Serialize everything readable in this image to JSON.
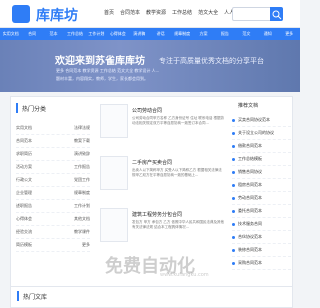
{
  "site": {
    "logo_text": "库库坊"
  },
  "header": {
    "nav": [
      "首页",
      "合同范本",
      "教学资源",
      "工作总结",
      "范文大全",
      "人人范文库"
    ],
    "search_placeholder": ""
  },
  "category_bar": [
    "实用文档",
    "合同",
    "范本",
    "工作总结",
    "工作计划",
    "心得体会",
    "演讲稿",
    "讲话",
    "规章制度",
    "方案",
    "报告",
    "范文",
    "通知",
    "更多"
  ],
  "hero": {
    "title": "欢迎来到苏雀库库坊",
    "subtitle": "专注于高质量优秀文档的分享平台",
    "line1": "更多 合同范本 教学资源 工作总结 范文大全 教学设计 人...",
    "line2": "题材丰富，内容翔实，教师，学生，家长都会用到。"
  },
  "left": {
    "title": "热门分类",
    "items": [
      {
        "name": "实用文档",
        "right": "法律法规"
      },
      {
        "name": "合同范本",
        "right": "教案下载"
      },
      {
        "name": "求职简历",
        "right": "演讲致辞"
      },
      {
        "name": "活动方案",
        "right": "工作报告"
      },
      {
        "name": "行政公文",
        "right": "党团工作"
      },
      {
        "name": "企业管理",
        "right": "规章制度"
      },
      {
        "name": "述职报告",
        "right": "工作计划"
      },
      {
        "name": "心得体会",
        "right": "其他文档"
      },
      {
        "name": "经验交流",
        "right": "教学课件"
      },
      {
        "name": "简历模板",
        "right": "更多"
      }
    ]
  },
  "center": {
    "cards": [
      {
        "title": "公司劳动合同",
        "desc": "公司劳动合同甲方名称 乙方身份证号 住址 联系电话 根据劳动法相关规定双方平等自愿协商一致签订本合同..."
      },
      {
        "title": "二手房产买卖合同",
        "desc": "出卖人以下简称甲方 买受人以下简称乙方 根据相关法律法规甲乙双方在平等自愿协商一致的基础上..."
      },
      {
        "title": "建筑工程劳务分包合同",
        "desc": "发包方 甲方 承包方 乙方 依照中华人民共和国民法典及其他有关法律法规 结合本工程具体情况..."
      }
    ]
  },
  "right": {
    "title": "推荐文档",
    "items": [
      "买卖合同协议范本",
      "关于设立公司的协议",
      "借款合同范本",
      "工作总结模板",
      "销售合同协议",
      "租房合同范本",
      "劳动合同范本",
      "委托合同范本",
      "技术服务合同",
      "合伙协议范本",
      "装修合同范本",
      "采购合同范本"
    ]
  },
  "section2": {
    "title": "热门文库"
  },
  "watermark": {
    "text": "免费自动化",
    "url": "www.kufangku.com"
  },
  "colors": {
    "brand": "#2f7df6",
    "hero_gradient": [
      "#6a81b8",
      "#7f93c8",
      "#5f78ae"
    ]
  }
}
